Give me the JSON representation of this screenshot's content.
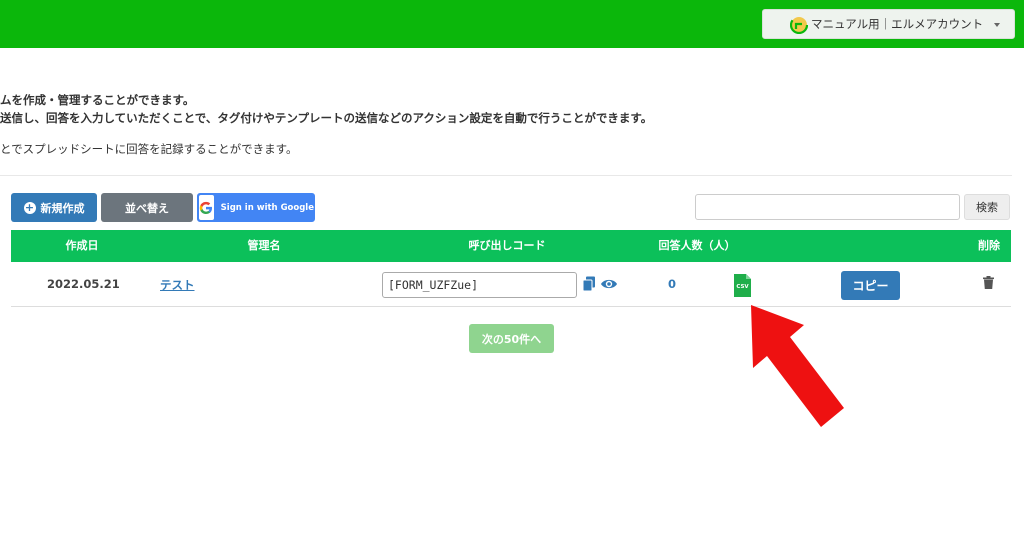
{
  "header": {
    "account_label": "マニュアル用｜エルメアカウント",
    "brand_color": "#0bb70b"
  },
  "description": {
    "line1": "ムを作成・管理することができます。",
    "line2": "送信し、回答を入力していただくことで、タグ付けやテンプレートの送信などのアクション設定を自動で行うことができます。",
    "line3": "とでスプレッドシートに回答を記録することができます。"
  },
  "toolbar": {
    "new_label": "新規作成",
    "sort_label": "並べ替え",
    "google_label": "Sign in with Google",
    "search_placeholder": "",
    "search_label": "検索"
  },
  "table": {
    "headers": [
      "作成日",
      "管理名",
      "呼び出しコード",
      "回答人数（人）",
      "削除"
    ],
    "header_color": "#0cc05a",
    "rows": [
      {
        "date": "2022.05.21",
        "name": "テスト",
        "code": "[FORM_UZFZue]",
        "count": "0",
        "csv_label": "CSV",
        "copy_label": "コピー"
      }
    ]
  },
  "pagination": {
    "next_label": "次の50件へ"
  },
  "annotation": {
    "arrow_color": "#ee1111"
  }
}
